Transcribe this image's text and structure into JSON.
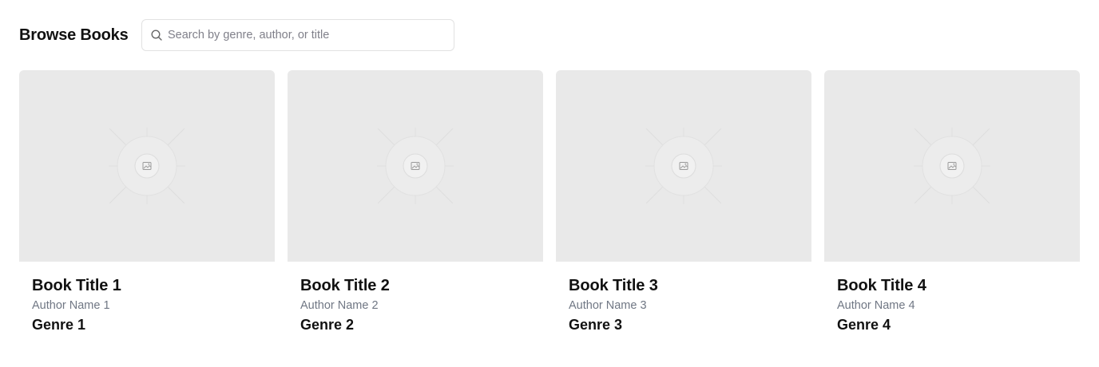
{
  "header": {
    "title": "Browse Books"
  },
  "search": {
    "placeholder": "Search by genre, author, or title",
    "value": "",
    "icon": "search-icon"
  },
  "books": [
    {
      "title": "Book Title 1",
      "author": "Author Name 1",
      "genre": "Genre 1",
      "cover_icon": "image-placeholder-icon"
    },
    {
      "title": "Book Title 2",
      "author": "Author Name 2",
      "genre": "Genre 2",
      "cover_icon": "image-placeholder-icon"
    },
    {
      "title": "Book Title 3",
      "author": "Author Name 3",
      "genre": "Genre 3",
      "cover_icon": "image-placeholder-icon"
    },
    {
      "title": "Book Title 4",
      "author": "Author Name 4",
      "genre": "Genre 4",
      "cover_icon": "image-placeholder-icon"
    }
  ],
  "colors": {
    "cover_background": "#e9e9e9",
    "author_text": "#707784",
    "input_border": "#e2e2e2"
  }
}
